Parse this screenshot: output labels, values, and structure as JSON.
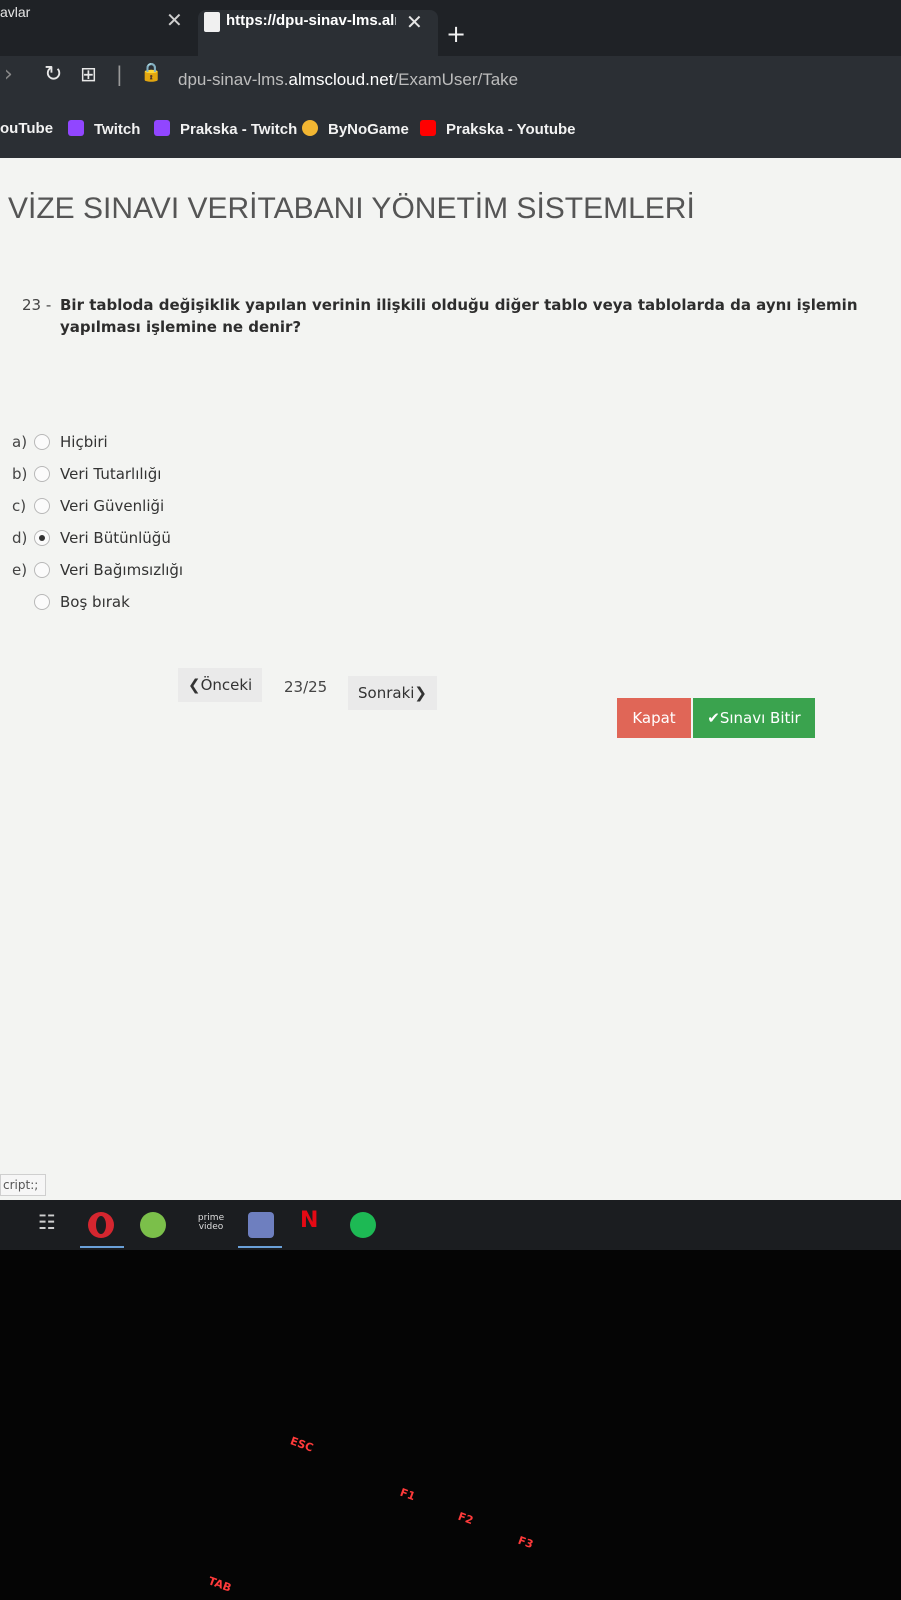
{
  "browser": {
    "prev_tab_title": "avlar",
    "active_tab_title": "https://dpu-sinav-lms.alms",
    "url_prefix": "dpu-sinav-lms.",
    "url_host": "almscloud.net",
    "url_path": "/ExamUser/Take",
    "bookmarks": [
      {
        "label": "ouTube",
        "icon": "youtube-icon",
        "color": "#ff0000"
      },
      {
        "label": "Twitch",
        "icon": "twitch-icon",
        "color": "#9146ff"
      },
      {
        "label": "Prakska - Twitch",
        "icon": "twitch-icon",
        "color": "#9146ff"
      },
      {
        "label": "ByNoGame",
        "icon": "bynogame-icon",
        "color": "#f2b632"
      },
      {
        "label": "Prakska - Youtube",
        "icon": "youtube-icon",
        "color": "#ff0000"
      }
    ]
  },
  "exam": {
    "title": "VİZE SINAVI VERİTABANI YÖNETİM SİSTEMLERİ",
    "question_number": "23 -",
    "question_text": "Bir tabloda değişiklik yapılan verinin ilişkili olduğu diğer tablo veya tablolarda da aynı işlemin yapılması işlemine ne denir?",
    "options": [
      {
        "letter": "a)",
        "label": "Hiçbiri",
        "selected": false
      },
      {
        "letter": "b)",
        "label": "Veri Tutarlılığı",
        "selected": false
      },
      {
        "letter": "c)",
        "label": "Veri Güvenliği",
        "selected": false
      },
      {
        "letter": "d)",
        "label": "Veri Bütünlüğü",
        "selected": true
      },
      {
        "letter": "e)",
        "label": "Veri Bağımsızlığı",
        "selected": false
      },
      {
        "letter": "",
        "label": "Boş bırak",
        "selected": false
      }
    ],
    "nav": {
      "prev_label": "❮Önceki",
      "page": "23/25",
      "next_label": "Sonraki❯"
    },
    "close_label": "Kapat",
    "finish_label": "✔Sınavı Bitir",
    "close_color": "#e06657",
    "finish_color": "#3aa34e"
  },
  "status_text": "cript:;",
  "taskbar": {
    "icons": [
      "task-view-icon",
      "opera-icon",
      "utorrent-icon",
      "prime-video-icon",
      "discord-icon",
      "netflix-icon",
      "spotify-icon"
    ],
    "prime_label": "prime video",
    "netflix_label": "N"
  },
  "keyboard": {
    "keys": [
      "ESC",
      "F1",
      "F2",
      "F3",
      "TAB"
    ]
  }
}
